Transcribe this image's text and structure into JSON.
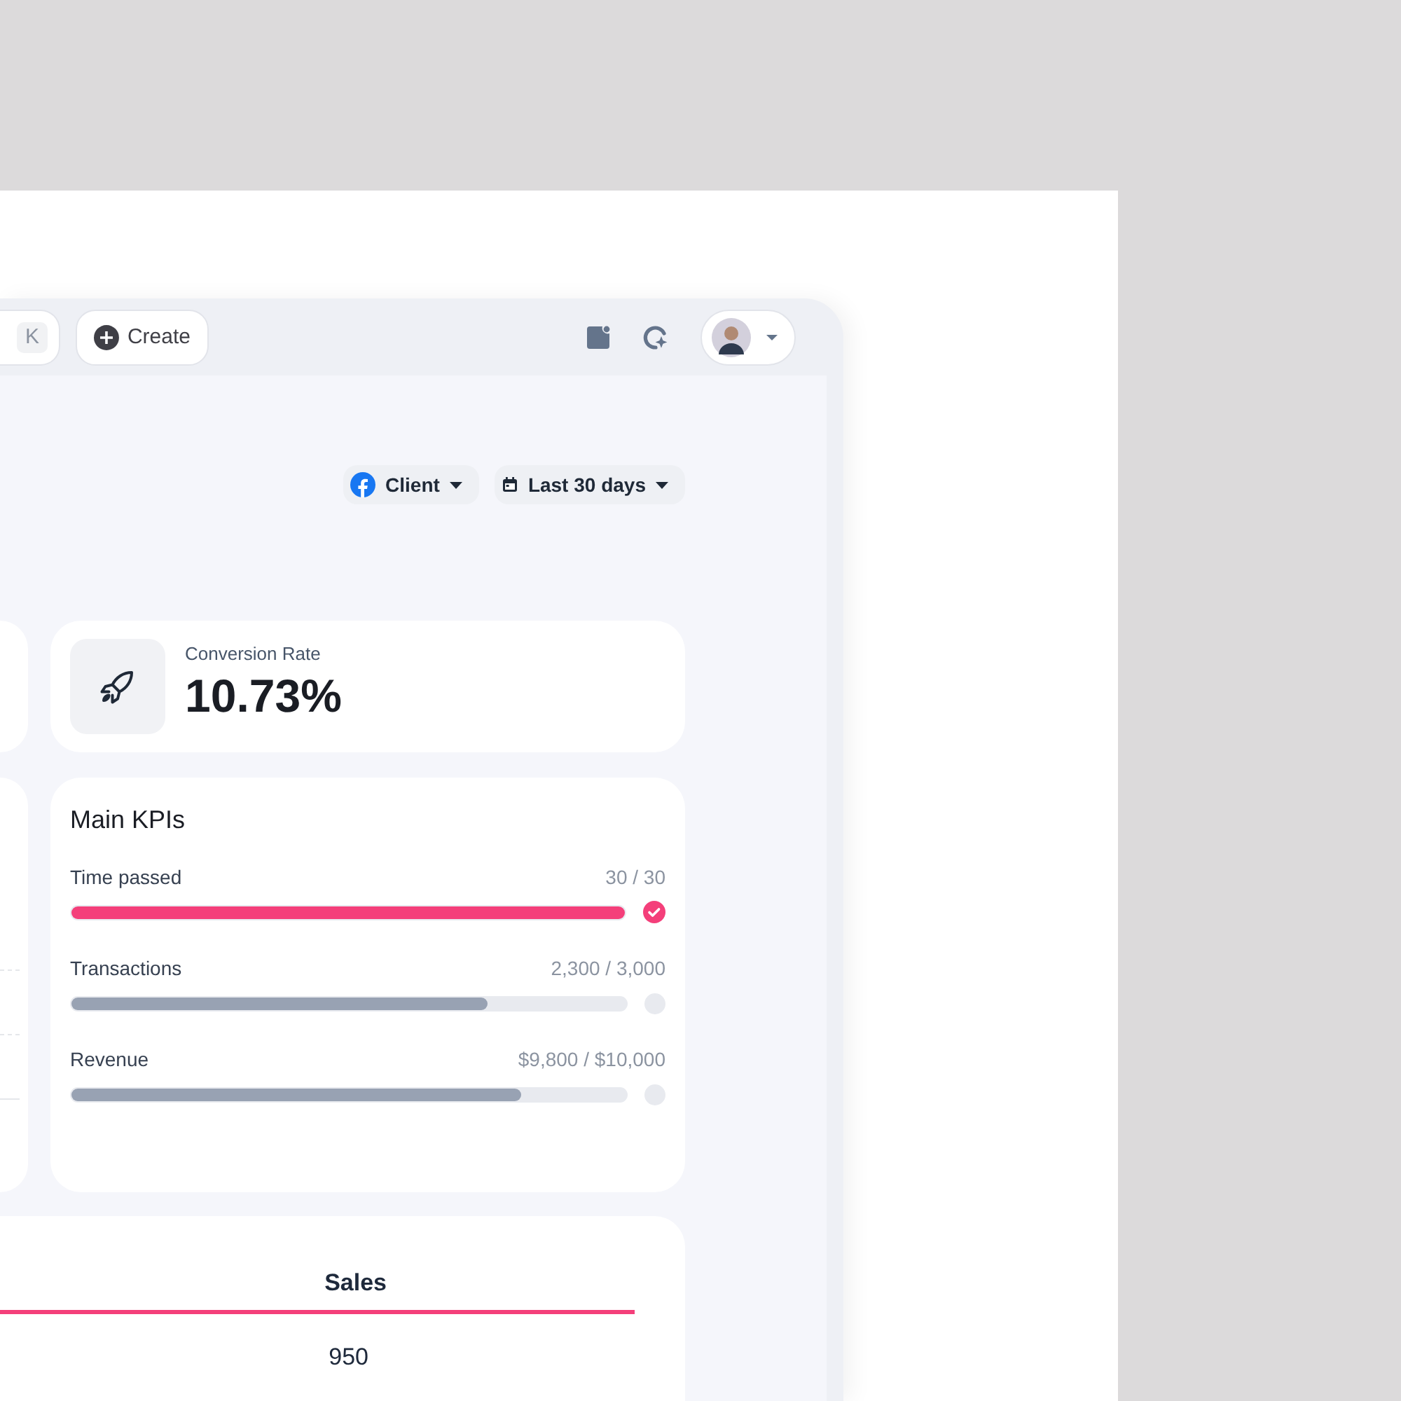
{
  "topbar": {
    "shortcut_key": "K",
    "create_button": "Create"
  },
  "filters": [
    {
      "kind": "facebook",
      "label": "Client"
    },
    {
      "kind": "calendar",
      "label": "Last 30 days"
    }
  ],
  "stat_card": {
    "label": "Conversion Rate",
    "value": "10.73%"
  },
  "kpis": {
    "title": "Main KPIs",
    "items": [
      {
        "label": "Time passed",
        "reading": "30 / 30",
        "level": 1,
        "done": true
      },
      {
        "label": "Transactions",
        "reading": "2,300 / 3,000",
        "level": 0.75,
        "done": false
      },
      {
        "label": "Revenue",
        "reading": "$9,800 / $10,000",
        "level": 0.81,
        "done": false
      }
    ]
  },
  "table": {
    "columns": [
      "Sales"
    ],
    "rows": [
      [
        "950"
      ]
    ]
  }
}
